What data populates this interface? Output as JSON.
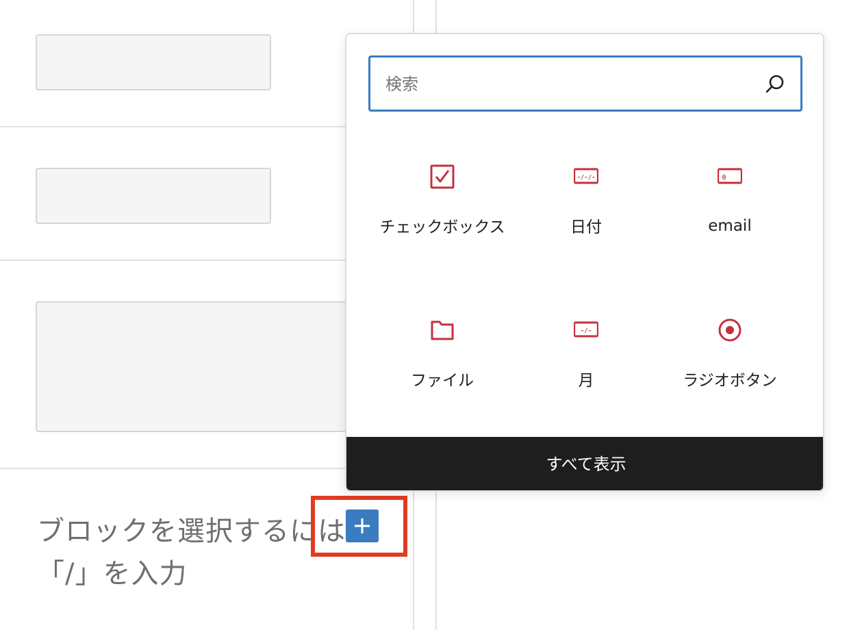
{
  "editor": {
    "paragraph_placeholder": {
      "line1": "ブロックを選択するには",
      "line2": "「/」を入力"
    },
    "inserter_toggle_icon": "plus-icon",
    "highlight_color": "#e23b22"
  },
  "inserter": {
    "search": {
      "placeholder": "検索",
      "value": "",
      "icon": "search-icon"
    },
    "blocks": [
      {
        "label": "チェックボックス",
        "icon": "checkbox-icon"
      },
      {
        "label": "日付",
        "icon": "date-field-icon"
      },
      {
        "label": "email",
        "icon": "email-field-icon"
      },
      {
        "label": "ファイル",
        "icon": "folder-icon"
      },
      {
        "label": "月",
        "icon": "month-field-icon"
      },
      {
        "label": "ラジオボタン",
        "icon": "radio-button-icon"
      }
    ],
    "browse_all_label": "すべて表示",
    "icon_color": "#c6303e",
    "accent_color": "#3a7cbf"
  }
}
